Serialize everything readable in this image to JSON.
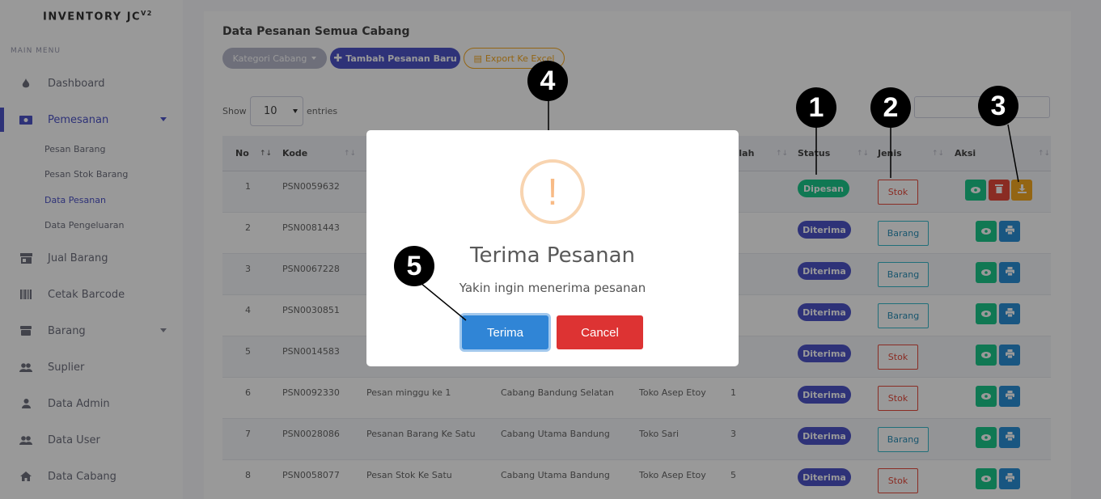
{
  "brand": {
    "name": "INVENTORY JC",
    "version": "V2"
  },
  "sidebar": {
    "heading": "MAIN MENU",
    "items": [
      {
        "label": "Dashboard",
        "icon": "fire-icon"
      },
      {
        "label": "Pemesanan",
        "icon": "money-icon",
        "active": true
      },
      {
        "label": "Jual Barang",
        "icon": "store-icon"
      },
      {
        "label": "Cetak Barcode",
        "icon": "barcode-icon"
      },
      {
        "label": "Barang",
        "icon": "box-icon"
      },
      {
        "label": "Suplier",
        "icon": "users-icon"
      },
      {
        "label": "Data Admin",
        "icon": "user-icon"
      },
      {
        "label": "Data User",
        "icon": "users-icon"
      },
      {
        "label": "Data Cabang",
        "icon": "home-icon"
      }
    ],
    "submenu": [
      "Pesan Barang",
      "Pesan Stok Barang",
      "Data Pesanan",
      "Data Pengeluaran"
    ]
  },
  "page": {
    "title": "Data Pesanan Semua Cabang",
    "btn_kategori": "Kategori Cabang",
    "btn_tambah": "Tambah Pesanan Baru",
    "btn_export": "Export Ke Excel"
  },
  "table_controls": {
    "show": "Show",
    "entries_value": "10",
    "entries": "entries"
  },
  "table": {
    "headers": {
      "no": "No",
      "kode": "Kode",
      "jumlah": "Jumlah",
      "status": "Status",
      "jenis": "Jenis",
      "aksi": "Aksi"
    },
    "rows": [
      {
        "no": "1",
        "kode": "PSN0059632",
        "nama": "",
        "cabang": "",
        "toko": "",
        "jumlah": "",
        "status": "Dipesan",
        "jenis": "Stok"
      },
      {
        "no": "2",
        "kode": "PSN0081443",
        "nama": "",
        "cabang": "",
        "toko": "",
        "jumlah": "",
        "status": "Diterima",
        "jenis": "Barang"
      },
      {
        "no": "3",
        "kode": "PSN0067228",
        "nama": "",
        "cabang": "",
        "toko": "",
        "jumlah": "",
        "status": "Diterima",
        "jenis": "Barang"
      },
      {
        "no": "4",
        "kode": "PSN0030851",
        "nama": "",
        "cabang": "",
        "toko": "",
        "jumlah": "",
        "status": "Diterima",
        "jenis": "Barang"
      },
      {
        "no": "5",
        "kode": "PSN0014583",
        "nama": "",
        "cabang": "",
        "toko": "",
        "jumlah": "",
        "status": "Diterima",
        "jenis": "Stok"
      },
      {
        "no": "6",
        "kode": "PSN0092330",
        "nama": "Pesan minggu ke 1",
        "cabang": "Cabang Bandung Selatan",
        "toko": "Toko Asep Etoy",
        "jumlah": "1",
        "status": "Diterima",
        "jenis": "Stok"
      },
      {
        "no": "7",
        "kode": "PSN0028086",
        "nama": "Pesanan Barang Ke Satu",
        "cabang": "Cabang Utama Bandung",
        "toko": "Toko Sari",
        "jumlah": "3",
        "status": "Diterima",
        "jenis": "Barang"
      },
      {
        "no": "8",
        "kode": "PSN0058077",
        "nama": "Pesan Stok Ke Satu",
        "cabang": "Cabang Utama Bandung",
        "toko": "Toko Asep Etoy",
        "jumlah": "5",
        "status": "Diterima",
        "jenis": "Stok"
      }
    ]
  },
  "modal": {
    "icon": "!",
    "title": "Terima Pesanan",
    "text": "Yakin ingin menerima pesanan",
    "confirm": "Terima",
    "cancel": "Cancel"
  },
  "markers": [
    "1",
    "2",
    "3",
    "4",
    "5"
  ],
  "colors": {
    "primary": "#4e54c8",
    "success": "#1cc88a",
    "danger": "#e74a3b",
    "warning": "#f6a821",
    "confirm": "#3085d6",
    "cancel": "#dd3333"
  }
}
